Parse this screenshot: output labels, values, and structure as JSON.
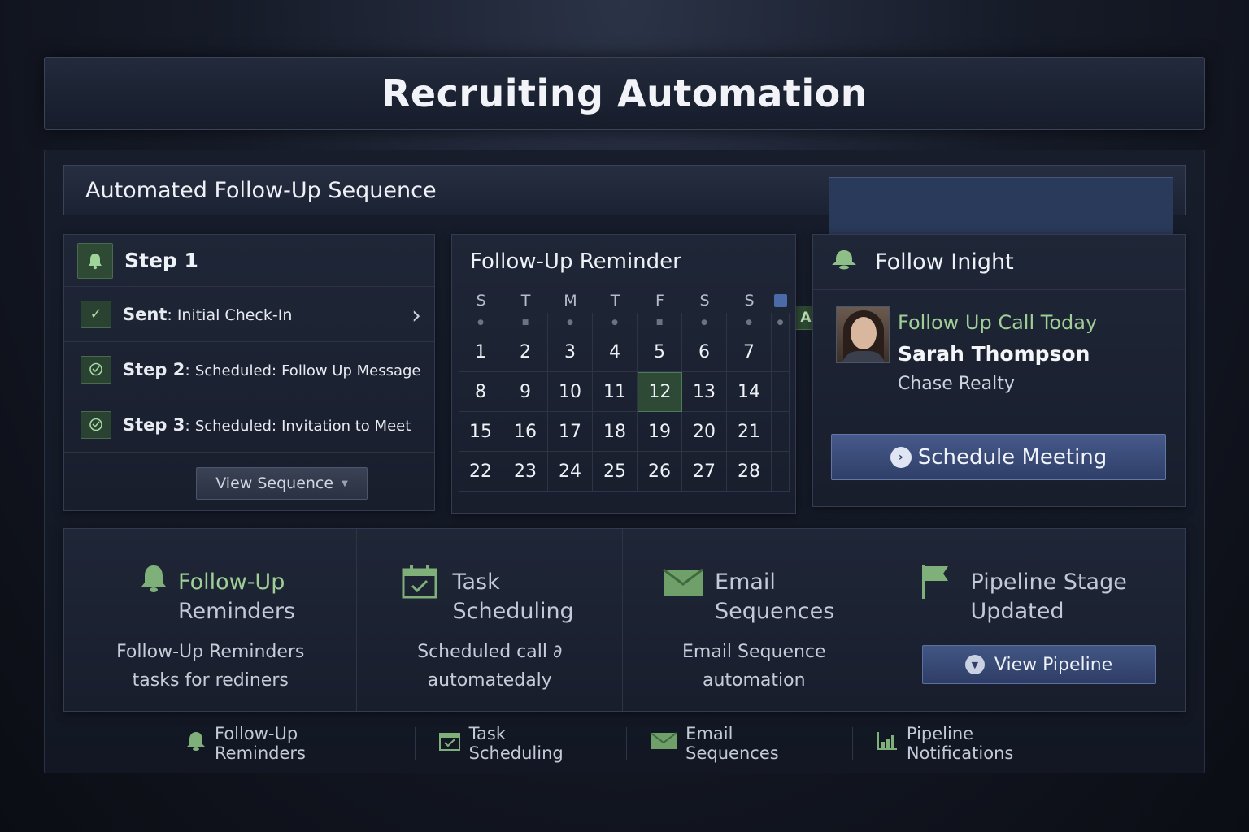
{
  "app_title": "Recruiting Automation",
  "sequence": {
    "title": "Automated Follow-Up Sequence",
    "header_icons": {
      "bell": "bell-icon",
      "a_label": "A",
      "calendar": "calendar-icon"
    }
  },
  "steps": {
    "header": "Step 1",
    "rows": [
      {
        "label": "Sent",
        "sep": ":",
        "detail": "Initial Check-In"
      },
      {
        "label": "Step 2",
        "sep": ":",
        "status": "Scheduled:",
        "detail": "Follow Up Message"
      },
      {
        "label": "Step 3",
        "sep": ":",
        "status": "Scheduled:",
        "detail": "Invitation to Meet"
      }
    ],
    "view_button": "View Sequence"
  },
  "calendar": {
    "title": "Follow-Up Reminder",
    "weekdays": [
      "S",
      "T",
      "M",
      "T",
      "F",
      "S",
      "S"
    ],
    "weeks": [
      [
        "1",
        "2",
        "3",
        "4",
        "5",
        "6",
        "7"
      ],
      [
        "8",
        "9",
        "10",
        "11",
        "12",
        "13",
        "14"
      ],
      [
        "15",
        "16",
        "17",
        "18",
        "19",
        "20",
        "21"
      ],
      [
        "22",
        "23",
        "24",
        "25",
        "26",
        "27",
        "28"
      ]
    ],
    "selected_day": "12"
  },
  "insight": {
    "title": "Follow Inight",
    "reminder": "Follow Up Call Today",
    "name": "Sarah Thompson",
    "company": "Chase Realty",
    "button": "Schedule Meeting"
  },
  "features": [
    {
      "icon": "bell-icon",
      "title_1": "Follow-Up",
      "title_2": "Reminders",
      "desc_1": "Follow-Up Reminders",
      "desc_2": "tasks for rediners"
    },
    {
      "icon": "calendar-check-icon",
      "title_1": "Task",
      "title_2": "Scheduling",
      "desc_1": "Scheduled call ∂",
      "desc_2": "automatedaly"
    },
    {
      "icon": "envelope-icon",
      "title_1": "Email",
      "title_2": "Sequences",
      "desc_1": "Email Sequence",
      "desc_2": "automation"
    },
    {
      "icon": "flag-icon",
      "title_1": "Pipeline Stage",
      "title_2": "Updated",
      "button": "View Pipeline"
    }
  ],
  "footer": [
    {
      "icon": "bell-icon",
      "label": "Follow-Up Reminders"
    },
    {
      "icon": "calendar-check-icon",
      "label": "Task Scheduling"
    },
    {
      "icon": "envelope-icon",
      "label": "Email Sequences"
    },
    {
      "icon": "bar-chart-icon",
      "label": "Pipeline Notifications"
    }
  ],
  "colors": {
    "accent_green": "#7fb07a",
    "accent_blue": "#3a4c7a",
    "background": "#131824"
  }
}
